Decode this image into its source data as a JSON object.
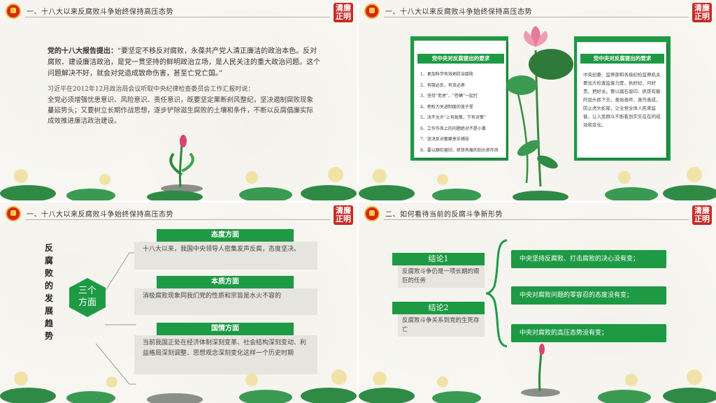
{
  "slides": {
    "s1": {
      "header": "一、十八大以来反腐败斗争始终保持高压态势",
      "stamp": [
        "清廉",
        "正明"
      ],
      "para1_bold": "党的十八大报告提出：",
      "para1": "“要坚定不移反对腐败，永葆共产党人清正廉洁的政治本色。反对腐败、建设廉洁政治，是党一贯坚持的鲜明政治立场，是人民关注的重大政治问题。这个问题解决不好，就会对党造成致命伤害，甚至亡党亡国。”",
      "para2": "习近平在2012年12月政治局会议听取中央纪律检查委员会工作汇报时说：",
      "para3": "全党必须增强忧患意识、风险意识、责任意识，既要坚定果断刹风整纪，坚决遏制腐败现象蔓延势头；又要树立长期作战思想，逐步铲除滋生腐败的土壤和条件，不断以反腐倡廉实际成效推进廉洁政治建设。"
    },
    "s2": {
      "header": "一、十八大以来反腐败斗争始终保持高压态势",
      "stamp": [
        "清廉",
        "正明"
      ],
      "left_title": "党中央对反腐提出的要求",
      "left_items": [
        "1、更加科学有效地防治腐败",
        "2、有腐必反，有贪必肃",
        "3、坚持“老虎”、“苍蝇”一起打",
        "4、把权力关进制度的笼子里",
        "5、决不允许“上有政策，下有对策”",
        "6、工作作风上的问题绝对不是小事",
        "7、坚决反对奢靡享乐铺张",
        "8、要以踏石留印、抓铁有痕的劲头抓作风"
      ],
      "right_title": "党中央对反腐提出的要求",
      "right_text": "中央纪委、监察部和各级纪检监察机关要加大检查监督力度，执好纪、问好责、把好关。要以踏石留印、抓铁有痕的劲头抓下去，善始善终、善作善成，防止虎头蛇尾，让全党全体人民来监督，让人民群众不断看到实实在在的成效和变化。"
    },
    "s3": {
      "header": "一、十八大以来反腐败斗争始终保持高压态势",
      "stamp": [
        "清廉",
        "正明"
      ],
      "vertical_title": "反腐败的发展趋势",
      "hex_label": [
        "三个",
        "方面"
      ],
      "items": [
        {
          "title": "态度方面",
          "text": "十八大以来，我国中央领导人密集发声反腐，态度坚决。"
        },
        {
          "title": "本质方面",
          "text": "消极腐败现象同我们党的性质和宗旨是水火不容的"
        },
        {
          "title": "国情方面",
          "text": "当前我国正处在经济体制深刻变革、社会结构深刻变动、利益格局深刻调整、思想观念深刻变化这样一个历史时期"
        }
      ]
    },
    "s4": {
      "header": "二、如何看待当前的反腐斗争新形势",
      "stamp": [
        "清廉",
        "正明"
      ],
      "conclusions": [
        {
          "title": "结论1",
          "text": "反腐败斗争仍是一项长期的艰巨的任务"
        },
        {
          "title": "结论2",
          "text": "反腐败斗争关系到党的生死存亡"
        }
      ],
      "points": [
        "中央坚持反腐败、打击腐败的决心没有变；",
        "中央对腐败问题的零容忍的态度没有变；",
        "中央对腐败的高压态势没有变；"
      ]
    }
  },
  "colors": {
    "green": "#1e9a44",
    "dark_green": "#167a36",
    "red": "#c62b26",
    "gray_box": "#e6e4df"
  }
}
